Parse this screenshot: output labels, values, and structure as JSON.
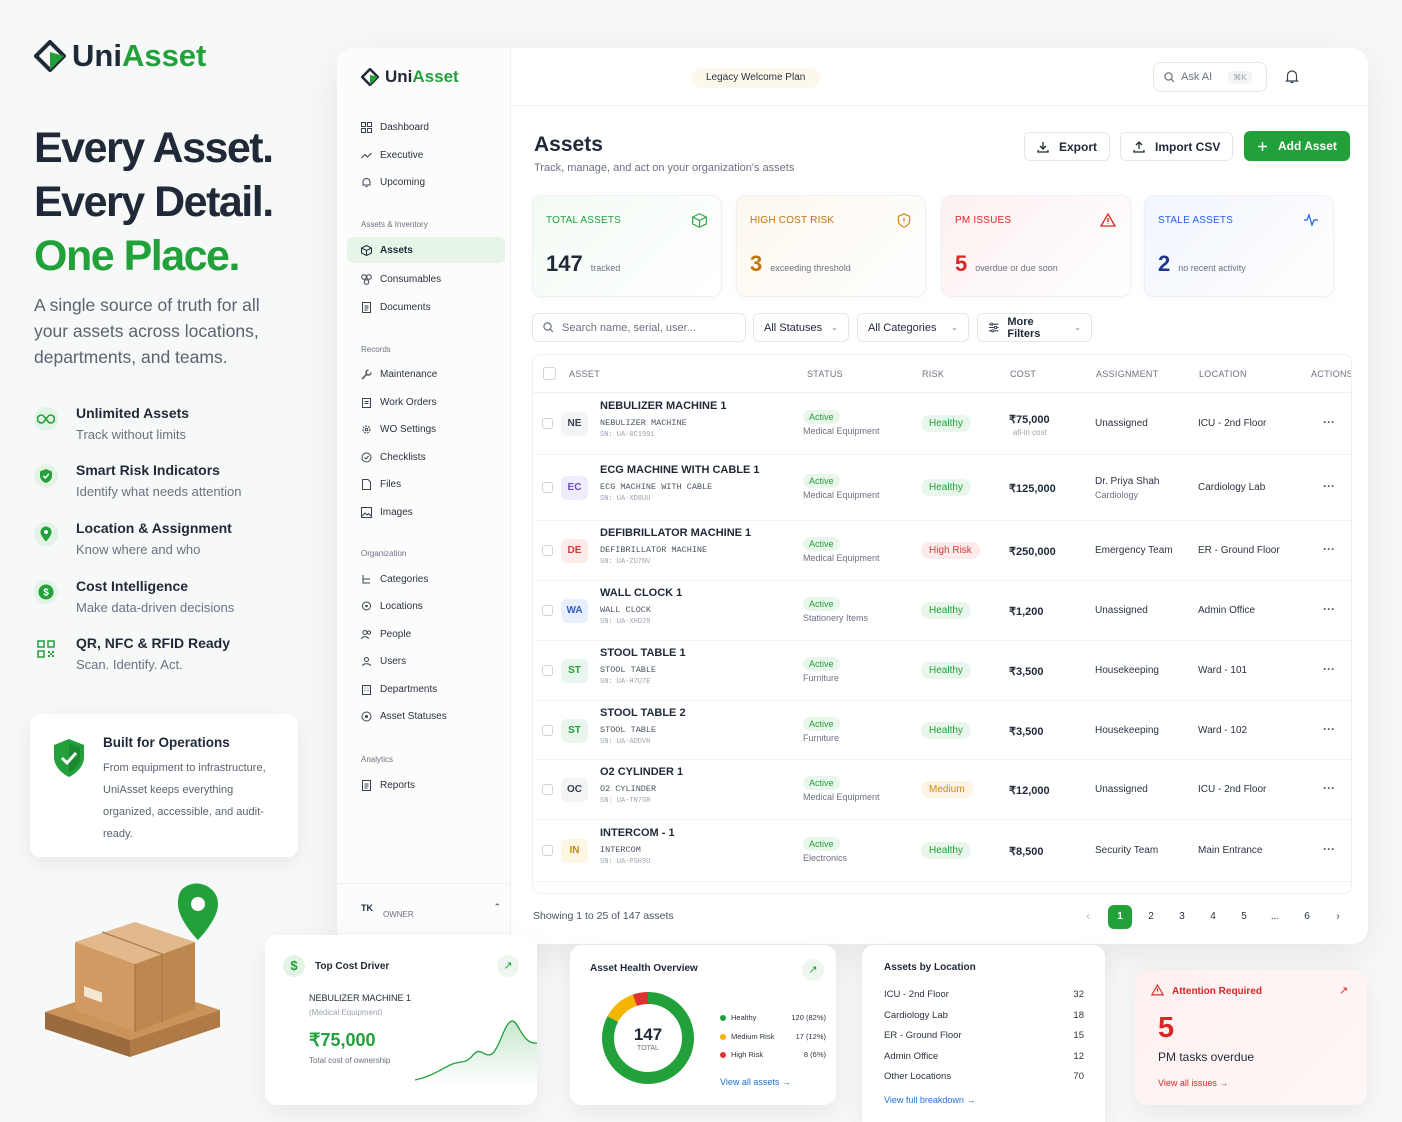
{
  "hero": {
    "brand_a": "Uni",
    "brand_b": "Asset",
    "line1": "Every Asset.",
    "line2": "Every Detail.",
    "line3": "One Place.",
    "subtitle": "A single source of truth for all your assets across locations, departments, and teams.",
    "features": [
      {
        "title": "Unlimited Assets",
        "sub": "Track without limits",
        "icon": "infinity-icon"
      },
      {
        "title": "Smart Risk Indicators",
        "sub": "Identify what needs attention",
        "icon": "shield-check-icon"
      },
      {
        "title": "Location & Assignment",
        "sub": "Know where and who",
        "icon": "location-pin-icon"
      },
      {
        "title": "Cost Intelligence",
        "sub": "Make data-driven decisions",
        "icon": "dollar-icon"
      },
      {
        "title": "QR, NFC & RFID Ready",
        "sub": "Scan. Identify. Act.",
        "icon": "qr-icon"
      }
    ],
    "ops_title": "Built for Operations",
    "ops_text": "From equipment to infrastructure, UniAsset keeps everything organized, accessible, and audit-ready."
  },
  "app": {
    "brand_a": "Uni",
    "brand_b": "Asset",
    "plan": "Legacy Welcome Plan",
    "ask_ai": "Ask AI",
    "ask_kbd": "⌘K",
    "avatar": "TK",
    "nav": {
      "top": [
        "Dashboard",
        "Executive",
        "Upcoming"
      ],
      "sec1": "Assets & Inventory",
      "inv": [
        "Assets",
        "Consumables",
        "Documents"
      ],
      "sec2": "Records",
      "records": [
        "Maintenance",
        "Work Orders",
        "WO Settings",
        "Checklists",
        "Files",
        "Images"
      ],
      "sec3": "Organization",
      "org": [
        "Categories",
        "Locations",
        "People",
        "Users",
        "Departments",
        "Asset Statuses"
      ],
      "sec4": "Analytics",
      "analytics": [
        "Reports"
      ],
      "user_initials": "TK",
      "user_role": "OWNER"
    },
    "page_title": "Assets",
    "page_sub": "Track, manage, and act on your organization's assets",
    "buttons": {
      "export": "Export",
      "import": "Import CSV",
      "add": "Add Asset"
    },
    "kpis": [
      {
        "label": "TOTAL ASSETS",
        "value": "147",
        "caption": "tracked",
        "color": "#22a13a",
        "icon": "cube-icon"
      },
      {
        "label": "HIGH COST RISK",
        "value": "3",
        "caption": "exceeding threshold",
        "color": "#c2740c",
        "icon": "shield-alert-icon"
      },
      {
        "label": "PM ISSUES",
        "value": "5",
        "caption": "overdue or due soon",
        "color": "#dc2626",
        "icon": "warning-icon"
      },
      {
        "label": "STALE ASSETS",
        "value": "2",
        "caption": "no recent activity",
        "color": "#2563eb",
        "icon": "activity-icon"
      }
    ],
    "search_placeholder": "Search name, serial, user...",
    "filters": {
      "status": "All Statuses",
      "category": "All Categories",
      "more": "More Filters"
    },
    "columns": [
      "ASSET",
      "STATUS",
      "RISK",
      "COST",
      "ASSIGNMENT",
      "LOCATION",
      "ACTIONS"
    ],
    "rows": [
      {
        "chip": "NE",
        "name": "NEBULIZER MACHINE 1",
        "mono": "NEBULIZER MACHINE",
        "sn": "SN: UA-0C1991",
        "status": "Active",
        "cat": "Medical Equipment",
        "risk": "Healthy",
        "cost": "₹75,000",
        "costsub": "all-in cost",
        "assign": "Unassigned",
        "assignsub": "",
        "loc": "ICU - 2nd Floor",
        "dots": "···"
      },
      {
        "chip": "EC",
        "name": "ECG MACHINE WITH CABLE 1",
        "mono": "ECG MACHINE WITH CABLE",
        "sn": "SN: UA-XD8UU",
        "status": "Active",
        "cat": "Medical Equipment",
        "risk": "Healthy",
        "cost": "₹125,000",
        "costsub": "",
        "assign": "Dr. Priya Shah",
        "assignsub": "Cardiology",
        "loc": "Cardiology Lab",
        "dots": "···"
      },
      {
        "chip": "DE",
        "name": "DEFIBRILLATOR MACHINE 1",
        "mono": "DEFIBRILLATOR MACHINE",
        "sn": "SN: UA-ZU7NV",
        "status": "Active",
        "cat": "Medical Equipment",
        "risk": "High Risk",
        "cost": "₹250,000",
        "costsub": "",
        "assign": "Emergency Team",
        "assignsub": "",
        "loc": "ER - Ground Floor",
        "dots": "···"
      },
      {
        "chip": "WA",
        "name": "WALL CLOCK 1",
        "mono": "WALL CLOCK",
        "sn": "SN: UA-XHD29",
        "status": "Active",
        "cat": "Stationery Items",
        "risk": "Healthy",
        "cost": "₹1,200",
        "costsub": "",
        "assign": "Unassigned",
        "assignsub": "",
        "loc": "Admin Office",
        "dots": "···"
      },
      {
        "chip": "ST",
        "name": "STOOL TABLE 1",
        "mono": "STOOL TABLE",
        "sn": "SN: UA-H7U7E",
        "status": "Active",
        "cat": "Furniture",
        "risk": "Healthy",
        "cost": "₹3,500",
        "costsub": "",
        "assign": "Housekeeping",
        "assignsub": "",
        "loc": "Ward - 101",
        "dots": "···"
      },
      {
        "chip": "ST",
        "name": "STOOL TABLE 2",
        "mono": "STOOL TABLE",
        "sn": "SN: UA-ADDVH",
        "status": "Active",
        "cat": "Furniture",
        "risk": "Healthy",
        "cost": "₹3,500",
        "costsub": "",
        "assign": "Housekeeping",
        "assignsub": "",
        "loc": "Ward - 102",
        "dots": "···"
      },
      {
        "chip": "OC",
        "name": "O2 CYLINDER 1",
        "mono": "O2 CYLINDER",
        "sn": "SN: UA-TN7GR",
        "status": "Active",
        "cat": "Medical Equipment",
        "risk": "Medium",
        "cost": "₹12,000",
        "costsub": "",
        "assign": "Unassigned",
        "assignsub": "",
        "loc": "ICU - 2nd Floor",
        "dots": "···"
      },
      {
        "chip": "IN",
        "name": "INTERCOM - 1",
        "mono": "INTERCOM",
        "sn": "SN: UA-PSH9U",
        "status": "Active",
        "cat": "Electronics",
        "risk": "Healthy",
        "cost": "₹8,500",
        "costsub": "",
        "assign": "Security Team",
        "assignsub": "",
        "loc": "Main Entrance",
        "dots": "···"
      }
    ],
    "showing": "Showing 1 to 25 of 147 assets",
    "pages": [
      "1",
      "2",
      "3",
      "4",
      "5",
      "...",
      "6"
    ],
    "prev": "‹",
    "next": "›"
  },
  "cards": {
    "top_cost": {
      "title": "Top Cost Driver",
      "asset": "NEBULIZER MACHINE 1",
      "cat": "(Medical Equipment)",
      "value": "₹75,000",
      "caption": "Total cost of ownership"
    },
    "health": {
      "title": "Asset Health Overview",
      "total": "147",
      "total_label": "TOTAL",
      "legend": [
        {
          "label": "Healthy",
          "value": "120 (82%)",
          "color": "#22a13a",
          "count": 120
        },
        {
          "label": "Medium Risk",
          "value": "17 (12%)",
          "color": "#f5b400",
          "count": 17
        },
        {
          "label": "High Risk",
          "value": "8 (6%)",
          "color": "#e03131",
          "count": 8
        }
      ],
      "link": "View all assets →"
    },
    "by_location": {
      "title": "Assets by Location",
      "rows": [
        {
          "name": "ICU - 2nd Floor",
          "count": "32"
        },
        {
          "name": "Cardiology Lab",
          "count": "18"
        },
        {
          "name": "ER - Ground Floor",
          "count": "15"
        },
        {
          "name": "Admin Office",
          "count": "12"
        },
        {
          "name": "Other Locations",
          "count": "70"
        }
      ],
      "link": "View full breakdown →"
    },
    "attention": {
      "title": "Attention Required",
      "value": "5",
      "text": "PM tasks overdue",
      "link": "View all issues →"
    }
  }
}
